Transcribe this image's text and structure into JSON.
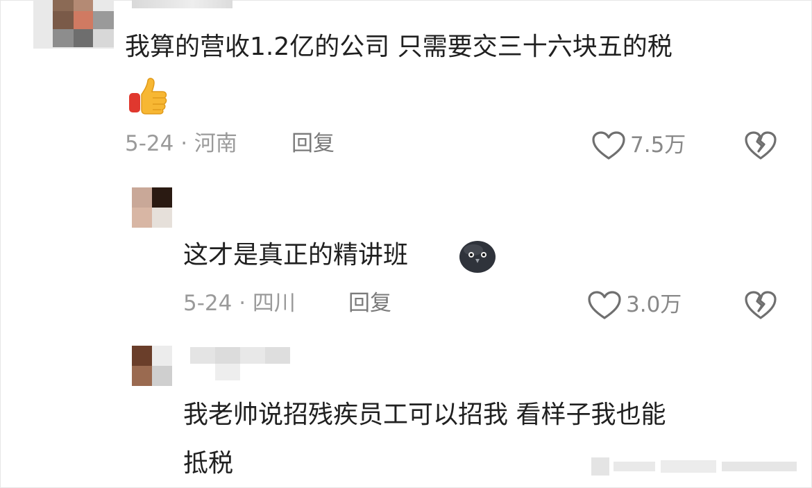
{
  "comments": [
    {
      "text": "我算的营收1.2亿的公司 只需要交三十六块五的税",
      "emoji": "👍",
      "meta": "5-24 · 河南",
      "reply_label": "回复",
      "likes": "7.5万",
      "avatar_colors": [
        "#8b6a55",
        "#c9a08c",
        "#6a4a3a",
        "#d9c0b0"
      ]
    },
    {
      "text": "这才是真正的精讲班",
      "emoji": "pigeon-face",
      "meta": "5-24 · 四川",
      "reply_label": "回复",
      "likes": "3.0万",
      "avatar_colors": [
        "#c9a898",
        "#2a1a12",
        "#d6c4b6",
        "#e6e0da"
      ]
    },
    {
      "text_line1": "我老帅说招残疾员工可以招我 看样子我也能",
      "text_line2": "抵税",
      "avatar_colors": [
        "#6a3e2a",
        "#e2e2e2",
        "#9a6a50",
        "#c8c8c8"
      ]
    }
  ],
  "colors": {
    "text": "#202020",
    "meta": "#9a9a9a",
    "icon": "#6f6f6f"
  }
}
